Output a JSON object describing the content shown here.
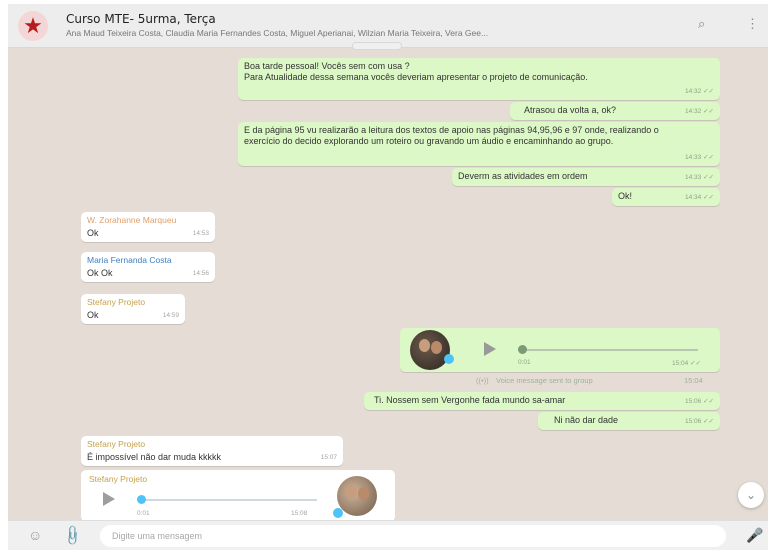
{
  "header": {
    "title": "Curso MTE- 5urma, Terça",
    "members": "Ana Maud Teixeira Costa, Claudia Maria Fernandes Costa, Miguel Aperianai, Wilzian Maria Teixeira, Vera Gee...",
    "search_icon": "search-icon",
    "menu_icon": "kebab-menu-icon"
  },
  "messages_out": [
    {
      "text": "Boa tarde pessoal! Vocês sem com usa ?\nPara Atualidade dessa semana vocês deveriam apresentar o projeto de comunicação.",
      "time": "14:32"
    },
    {
      "text": "Atrasou da volta a, ok?",
      "time": "14:32"
    },
    {
      "text": "E da página 95 vu realizarão a leitura dos textos de apoio nas páginas 94,95,96 e 97 onde, realizando o exercício do decido explorando um roteiro ou gravando um áudio e encaminhando ao grupo.",
      "time": "14:33"
    },
    {
      "text": "Deverm as atividades em ordem",
      "time": "14:33"
    },
    {
      "text": "Ok!",
      "time": "14:34"
    }
  ],
  "messages_in": [
    {
      "sender": "W. Zorahanne Marqueu",
      "text": "Ok",
      "time": "14:53"
    },
    {
      "sender": "Maria Fernanda Costa",
      "text": "Ok Ok",
      "time": "14:56"
    },
    {
      "sender": "Stefany Projeto",
      "text": "Ok",
      "time": "14:59"
    }
  ],
  "audio_out": {
    "duration": "0:01",
    "time": "15:04"
  },
  "system_note": {
    "text": "Voice message sent to group",
    "time": "15:04"
  },
  "messages_out_2": [
    {
      "text": "Ti. Nossem sem Vergonhe fada mundo sa-amar",
      "time": "15:06"
    },
    {
      "text": "Ni não dar dade",
      "time": "15:06"
    }
  ],
  "message_in_2": {
    "sender": "Stefany Projeto",
    "text": "É impossível não dar muda kkkkk",
    "time": "15:07"
  },
  "audio_in": {
    "sender": "Stefany Projeto",
    "duration": "0:01",
    "time": "15:08"
  },
  "compose": {
    "placeholder": "Digite uma mensagem"
  },
  "colors": {
    "outgoing": "#dcf8c6",
    "incoming": "#ffffff",
    "chat_bg": "#e5ddd5",
    "accent": "#4fc3f7"
  }
}
